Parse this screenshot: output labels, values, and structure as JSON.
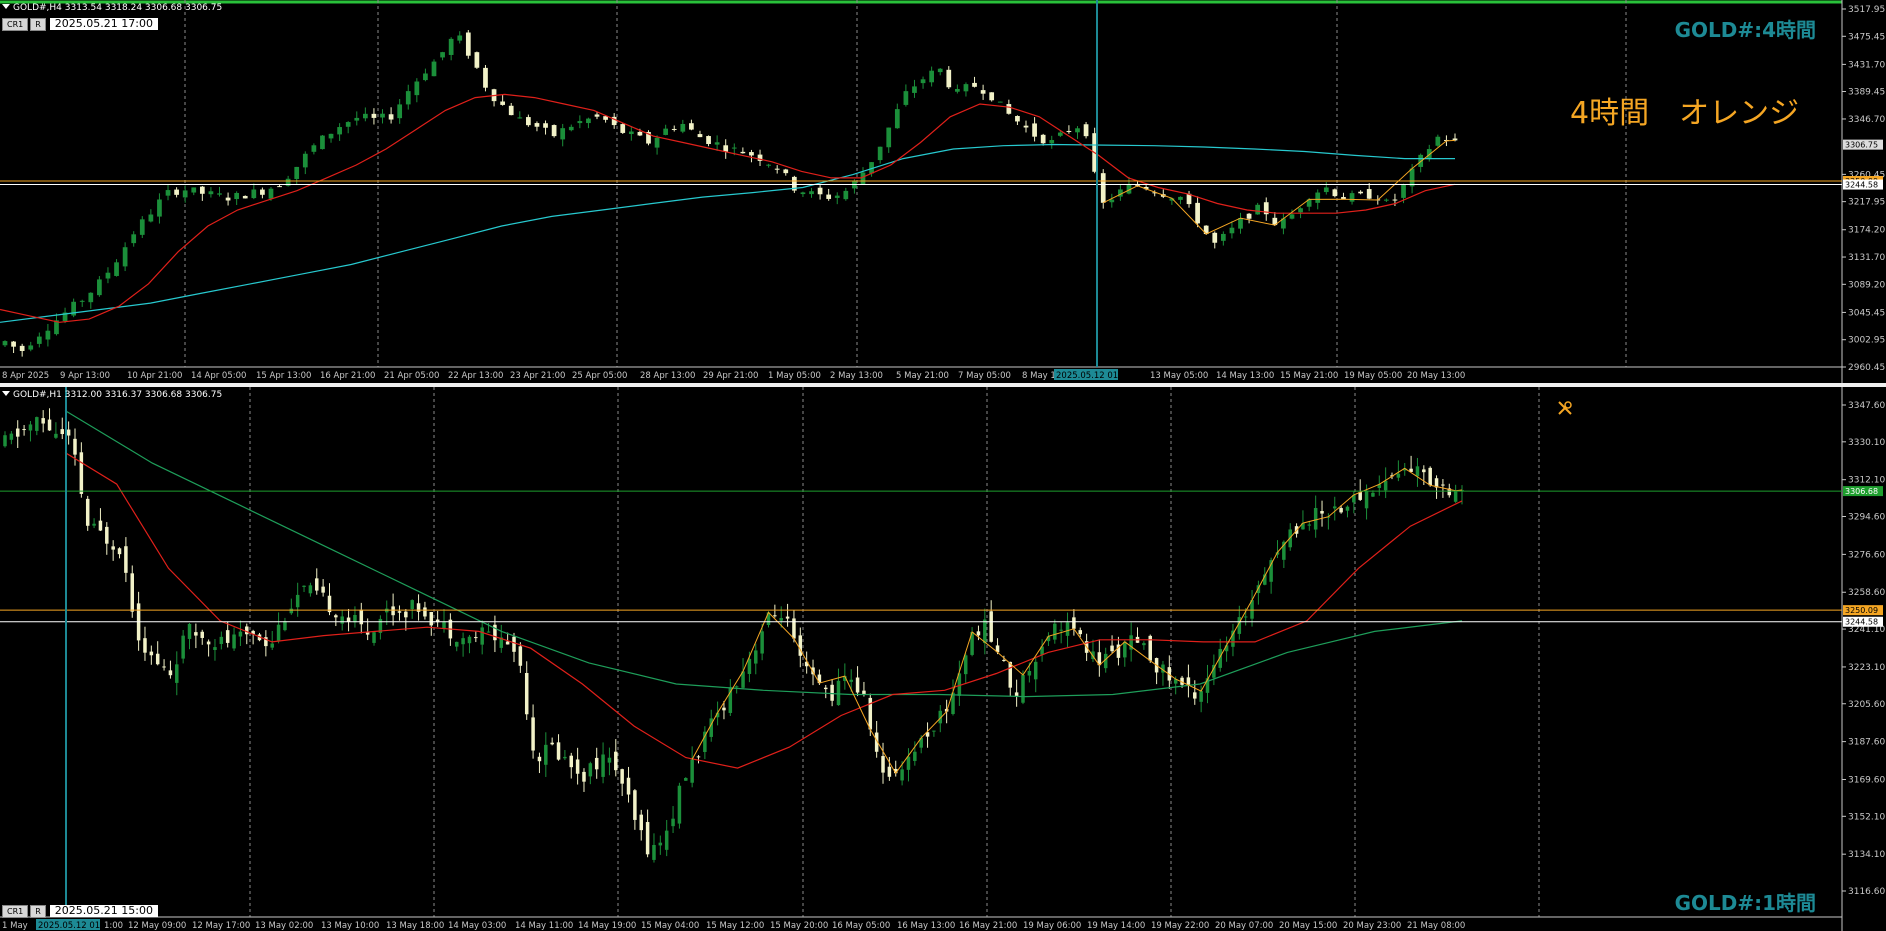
{
  "colors": {
    "background": "#000000",
    "candle_up": "#1b8f3a",
    "candle_down": "#f2f2c8",
    "ma_short": "#e0201a",
    "ma_long_top": "#27c9cf",
    "ma_long_bottom": "#1e9e5a",
    "zigzag": "#f5a623",
    "hline_orange": "#f5a623",
    "hline_white": "#ffffff",
    "hline_green": "#1e9e2e",
    "cursor_line": "#1d8a95",
    "grid": "#8a8a8a",
    "axis_text": "#c8c8c8",
    "timeframe_label": "#1d8a95",
    "annotation": "#f5a623"
  },
  "top_pane": {
    "header": "GOLD#,H4  3313.54 3318.24 3306.68 3306.75",
    "btn1": "CR1",
    "btn2": "R",
    "datetime": "2025.05.21 17:00",
    "timeframe_label": "GOLD#:4時間",
    "annotation": "4時間　オレンジ",
    "price_ticks": [
      "3517.95",
      "3475.45",
      "3431.70",
      "3389.45",
      "3346.70",
      "3260.45",
      "3217.95",
      "3174.20",
      "3131.70",
      "3089.20",
      "3045.45",
      "3002.95",
      "2960.45"
    ],
    "current_price": "3306.75",
    "line_price_orange": "3250.09",
    "line_price_white": "3244.58",
    "time_labels": [
      "8 Apr 2025",
      "9 Apr 13:00",
      "10 Apr 21:00",
      "14 Apr 05:00",
      "15 Apr 13:00",
      "16 Apr 21:00",
      "21 Apr 05:00",
      "22 Apr 13:00",
      "23 Apr 21:00",
      "25 Apr 05:00",
      "28 Apr 13:00",
      "29 Apr 21:00",
      "1 May 05:00",
      "2 May 13:00",
      "5 May 21:00",
      "7 May 05:00",
      "8 May 1",
      "2025.05.12 01:00",
      "13 May 05:00",
      "14 May 13:00",
      "15 May 21:00",
      "19 May 05:00",
      "20 May 13:00"
    ]
  },
  "bottom_pane": {
    "header": "GOLD#,H1  3312.00 3316.37 3306.68 3306.75",
    "btn1": "CR1",
    "btn2": "R",
    "datetime": "2025.05.21 15:00",
    "timeframe_label": "GOLD#:1時間",
    "price_ticks": [
      "3347.60",
      "3330.10",
      "3312.10",
      "3294.60",
      "3276.60",
      "3258.60",
      "3241.10",
      "3223.10",
      "3205.60",
      "3187.60",
      "3169.60",
      "3152.10",
      "3134.10",
      "3116.60"
    ],
    "current_price": "3306.68",
    "line_price_orange": "3250.09",
    "line_price_white": "3244.58",
    "time_labels": [
      "1 May",
      "2025.05.12 01:00",
      "1:00",
      "12 May 09:00",
      "12 May 17:00",
      "13 May 02:00",
      "13 May 10:00",
      "13 May 18:00",
      "14 May 03:00",
      "14 May 11:00",
      "14 May 19:00",
      "15 May 04:00",
      "15 May 12:00",
      "15 May 20:00",
      "16 May 05:00",
      "16 May 13:00",
      "16 May 21:00",
      "19 May 06:00",
      "19 May 14:00",
      "19 May 22:00",
      "20 May 07:00",
      "20 May 15:00",
      "20 May 23:00",
      "21 May 08:00"
    ]
  },
  "chart_data": [
    {
      "type": "candlestick",
      "title": "GOLD#,H4",
      "ylim": [
        2960.45,
        3517.95
      ],
      "grid": true,
      "close_points": [
        3000,
        2985,
        3010,
        3030,
        3050,
        3070,
        3095,
        3130,
        3170,
        3200,
        3230,
        3238,
        3232,
        3228,
        3224,
        3230,
        3235,
        3245,
        3270,
        3300,
        3322,
        3340,
        3350,
        3345,
        3352,
        3390,
        3420,
        3445,
        3480,
        3440,
        3390,
        3365,
        3345,
        3335,
        3320,
        3335,
        3345,
        3350,
        3330,
        3320,
        3310,
        3330,
        3340,
        3320,
        3310,
        3300,
        3295,
        3285,
        3270,
        3240,
        3230,
        3225,
        3230,
        3255,
        3290,
        3340,
        3390,
        3410,
        3425,
        3385,
        3400,
        3390,
        3360,
        3340,
        3320,
        3310,
        3330,
        3340,
        3210,
        3230,
        3245,
        3240,
        3230,
        3225,
        3190,
        3150,
        3170,
        3195,
        3210,
        3180,
        3200,
        3230,
        3240,
        3225,
        3225,
        3230,
        3210,
        3250,
        3290,
        3320,
        3310
      ],
      "ma_short": [
        3050,
        3040,
        3030,
        3035,
        3055,
        3090,
        3140,
        3180,
        3205,
        3220,
        3235,
        3255,
        3275,
        3300,
        3330,
        3360,
        3380,
        3385,
        3380,
        3370,
        3360,
        3340,
        3320,
        3310,
        3300,
        3290,
        3280,
        3265,
        3255,
        3255,
        3275,
        3310,
        3350,
        3370,
        3365,
        3350,
        3320,
        3290,
        3255,
        3240,
        3230,
        3215,
        3205,
        3200,
        3200,
        3200,
        3205,
        3215,
        3235,
        3245
      ],
      "ma_long": [
        3030,
        3040,
        3050,
        3060,
        3075,
        3090,
        3105,
        3120,
        3140,
        3160,
        3180,
        3195,
        3205,
        3215,
        3225,
        3232,
        3240,
        3260,
        3285,
        3300,
        3305,
        3307,
        3306,
        3305,
        3303,
        3300,
        3296,
        3290,
        3285,
        3285
      ],
      "hlines": [
        3250.09,
        3244.58
      ],
      "current_price": 3306.75
    },
    {
      "type": "candlestick",
      "title": "GOLD#,H1",
      "ylim": [
        3116.6,
        3347.6
      ],
      "grid": true,
      "close_points": [
        3330,
        3335,
        3340,
        3335,
        3330,
        3290,
        3285,
        3280,
        3240,
        3225,
        3220,
        3240,
        3238,
        3235,
        3236,
        3240,
        3234,
        3250,
        3260,
        3256,
        3250,
        3245,
        3240,
        3250,
        3250,
        3252,
        3245,
        3240,
        3236,
        3240,
        3236,
        3230,
        3180,
        3185,
        3178,
        3172,
        3180,
        3175,
        3150,
        3135,
        3145,
        3170,
        3185,
        3200,
        3215,
        3228,
        3245,
        3250,
        3225,
        3215,
        3210,
        3220,
        3205,
        3170,
        3175,
        3185,
        3195,
        3205,
        3230,
        3245,
        3230,
        3210,
        3225,
        3240,
        3245,
        3235,
        3225,
        3230,
        3235,
        3230,
        3220,
        3215,
        3210,
        3225,
        3235,
        3250,
        3270,
        3280,
        3290,
        3295,
        3298,
        3300,
        3305,
        3310,
        3315,
        3318,
        3312,
        3309,
        3307
      ],
      "ma_short": [
        3325,
        3310,
        3270,
        3245,
        3235,
        3238,
        3240,
        3242,
        3240,
        3232,
        3215,
        3195,
        3180,
        3175,
        3185,
        3200,
        3210,
        3212,
        3220,
        3230,
        3236,
        3236,
        3235,
        3235,
        3245,
        3270,
        3290,
        3302
      ],
      "ma_long": [
        3345,
        3320,
        3300,
        3280,
        3260,
        3240,
        3225,
        3215,
        3212,
        3210,
        3210,
        3209,
        3210,
        3215,
        3230,
        3240,
        3245
      ],
      "hlines": [
        3250.09,
        3244.58,
        3306.68
      ],
      "current_price": 3306.68
    }
  ]
}
